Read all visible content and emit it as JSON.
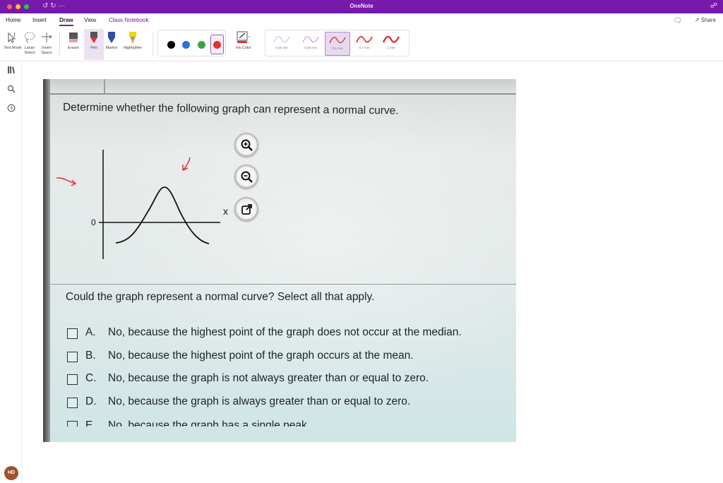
{
  "window": {
    "title": "OneNote",
    "title_glyphs": "↺ ↻ ···"
  },
  "menu": {
    "tabs": [
      "Home",
      "Insert",
      "Draw",
      "View",
      "Class Notebook"
    ],
    "active_tab": "Draw",
    "share_label": "Share"
  },
  "ribbon": {
    "tools": [
      "Text Mode",
      "Lasso Select",
      "Insert Space",
      "Eraser",
      "Pen",
      "Marker",
      "Highlighter"
    ],
    "ink_colors": [
      "#000000",
      "#2f6fd8",
      "#3aa63a",
      "#e23232"
    ],
    "selected_color": "#e23232",
    "ink_color_label": "Ink Color",
    "widths": [
      "0.25 mm",
      "0.35 mm",
      "0.5 mm",
      "0.7 mm",
      "1 mm"
    ],
    "selected_width": "0.5 mm",
    "accent": "#7719aa"
  },
  "sidebar": {
    "icons": [
      "notebooks-icon",
      "search-icon",
      "recent-icon"
    ],
    "avatar_initials": "HD"
  },
  "photo": {
    "question": "Determine whether the following graph can represent a normal curve.",
    "graph_zero_label": "0",
    "graph_x_label": "x",
    "question2": "Could the graph represent a normal curve? Select all that apply.",
    "options": [
      {
        "letter": "A.",
        "text": "No, because the highest point of the graph does not occur at the median."
      },
      {
        "letter": "B.",
        "text": "No, because the highest point of the graph occurs at the mean."
      },
      {
        "letter": "C.",
        "text": "No, because the graph is not always greater than or equal to zero."
      },
      {
        "letter": "D.",
        "text": "No, because the graph is always greater than or equal to zero."
      }
    ],
    "cut_option": {
      "letter": "E.",
      "text": "No, because the graph has a single peak."
    }
  }
}
